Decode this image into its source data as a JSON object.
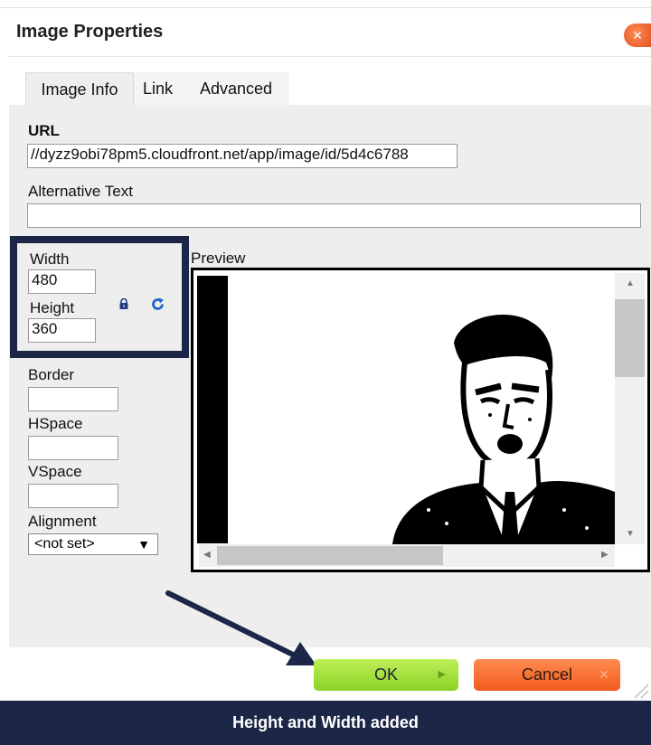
{
  "dialog": {
    "title": "Image Properties",
    "close_symbol": "✕"
  },
  "tabs": [
    {
      "label": "Image Info",
      "active": true
    },
    {
      "label": "Link",
      "active": false
    },
    {
      "label": "Advanced",
      "active": false
    }
  ],
  "fields": {
    "url_label": "URL",
    "url_value": "//dyzz9obi78pm5.cloudfront.net/app/image/id/5d4c6788",
    "alt_label": "Alternative Text",
    "alt_value": "",
    "width_label": "Width",
    "width_value": "480",
    "height_label": "Height",
    "height_value": "360",
    "border_label": "Border",
    "border_value": "",
    "hspace_label": "HSpace",
    "hspace_value": "",
    "vspace_label": "VSpace",
    "vspace_value": "",
    "alignment_label": "Alignment",
    "alignment_value": "<not set>",
    "alignment_arrow": "▼"
  },
  "preview": {
    "label": "Preview",
    "image": "man-shouting-illustration"
  },
  "buttons": {
    "ok_label": "OK",
    "ok_symbol": "▶",
    "cancel_label": "Cancel",
    "cancel_symbol": "✕"
  },
  "annotation": {
    "caption": "Height and Width added",
    "highlight_color": "#1c2747"
  },
  "icons": {
    "lock": "lock-icon",
    "reset": "reset-size-icon"
  },
  "colors": {
    "ok_green": "#a6e33a",
    "cancel_orange": "#f26a2b",
    "panel_gray": "#eeeeee"
  }
}
